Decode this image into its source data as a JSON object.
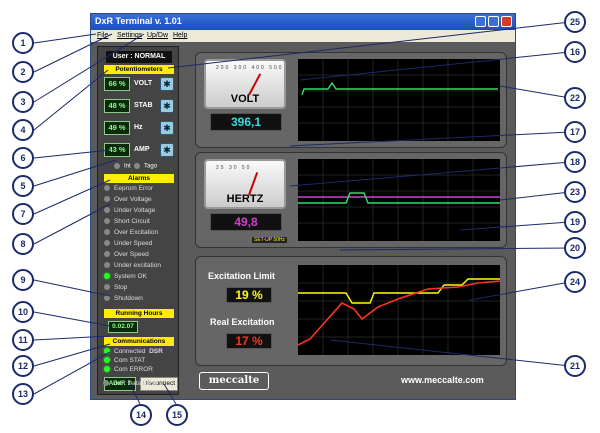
{
  "window": {
    "title": "DxR Terminal v. 1.01"
  },
  "menu": {
    "file": "File",
    "settings": "Settings",
    "updown": "Up/Dw",
    "help": "Help"
  },
  "user": {
    "label": "User : NORMAL"
  },
  "potentiometers": {
    "header": "Potentiometers",
    "items": [
      {
        "value": "66 %",
        "name": "VOLT",
        "icon": "knob-icon"
      },
      {
        "value": "48 %",
        "name": "STAB",
        "icon": "knob-icon"
      },
      {
        "value": "49 %",
        "name": "Hz",
        "icon": "knob-icon"
      },
      {
        "value": "43 %",
        "name": "AMP",
        "icon": "knob-icon"
      }
    ]
  },
  "radio": {
    "opt1": "Int",
    "opt2": "Tago"
  },
  "alarms": {
    "header": "Alarms",
    "items": [
      {
        "label": "Eeprom Error",
        "active": false
      },
      {
        "label": "Over Voltage",
        "active": false
      },
      {
        "label": "Under Voltage",
        "active": false
      },
      {
        "label": "Short Circuit",
        "active": false
      },
      {
        "label": "Over Excitation",
        "active": false
      },
      {
        "label": "Under Speed",
        "active": false
      },
      {
        "label": "Over Speed",
        "active": false
      },
      {
        "label": "Under excitation",
        "active": false
      },
      {
        "label": "System OK",
        "active": true
      },
      {
        "label": "Stop",
        "active": false
      },
      {
        "label": "Shutdown",
        "active": false
      }
    ]
  },
  "running_hours": {
    "header": "Running Hours",
    "value": "0.02.07"
  },
  "communications": {
    "header": "Communications",
    "connected": "Connected",
    "device": "DSR",
    "com_stat": "Com STAT",
    "com_error": "Com ERROR",
    "dxr_error": "DxR Data Error",
    "addr": "Addr: 1",
    "disconnect": "Disconnect"
  },
  "volt": {
    "label": "VOLT",
    "reading": "396,1",
    "scale": "200  300  400  500",
    "chart_scale_note": "SE"
  },
  "hertz": {
    "label": "HERTZ",
    "reading": "49,8",
    "scale": "25  30  50",
    "setup": "SET-UP 50Hz"
  },
  "excitation": {
    "limit_label": "Excitation Limit",
    "limit_value": "19 %",
    "real_label": "Real Excitation",
    "real_value": "17 %"
  },
  "footer": {
    "logo": "meccalte",
    "url": "www.meccalte.com"
  },
  "colors": {
    "volt": "#33dddd",
    "hertz": "#cc44cc",
    "limit": "#ffff00",
    "real": "#ff3322",
    "trace_green": "#33dd66"
  },
  "callouts": [
    "1",
    "2",
    "3",
    "4",
    "5",
    "6",
    "7",
    "8",
    "9",
    "10",
    "11",
    "12",
    "13",
    "14",
    "15",
    "16",
    "17",
    "18",
    "19",
    "20",
    "21",
    "22",
    "23",
    "24",
    "25"
  ]
}
